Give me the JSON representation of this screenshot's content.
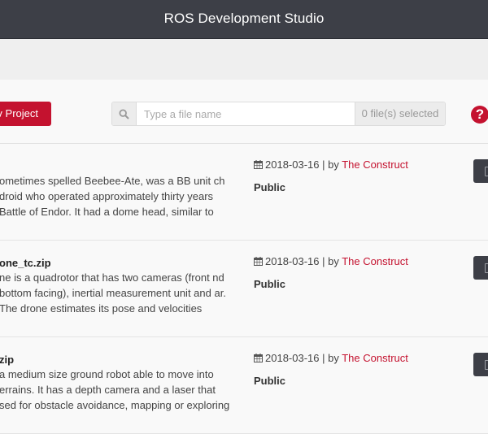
{
  "app": {
    "title": "ROS Development Studio"
  },
  "toolbar": {
    "new_project_label": "v Project",
    "search_placeholder": "Type a file name",
    "selected_count": "0 file(s) selected",
    "help_label": "?",
    "search_icon": "search-icon",
    "help_icon": "question-circle-icon"
  },
  "projects": [
    {
      "name": "",
      "description": "ometimes spelled Beebee-Ate, was a BB unit ch droid who operated approximately thirty years Battle of Endor. It had a dome head, similar to",
      "date": "2018-03-16",
      "by": "| by",
      "author": "The Construct",
      "visibility": "Public"
    },
    {
      "name": "one_tc.zip",
      "description": "ne is a quadrotor that has two cameras (front nd bottom facing), inertial measurement unit and ar. The drone estimates its pose and velocities",
      "date": "2018-03-16",
      "by": "| by",
      "author": "The Construct",
      "visibility": "Public"
    },
    {
      "name": "zip",
      "description": "a medium size ground robot able to move into errains. It has a depth camera and a laser that sed for obstacle avoidance, mapping or exploring",
      "date": "2018-03-16",
      "by": "| by",
      "author": "The Construct",
      "visibility": "Public"
    }
  ],
  "colors": {
    "accent": "#c4122f",
    "topbar": "#3d3f47"
  }
}
